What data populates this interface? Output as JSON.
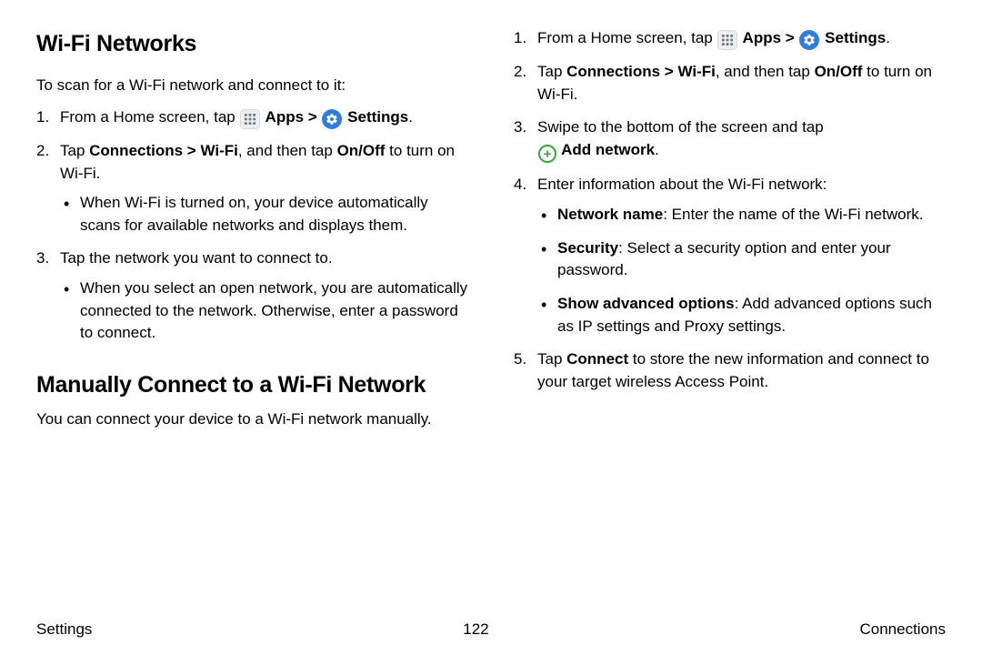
{
  "left": {
    "h1": "Wi-Fi Networks",
    "intro": "To scan for a Wi-Fi network and connect to it:",
    "step1_a": "From a Home screen, tap ",
    "step1_apps": " Apps",
    "step1_sep": " > ",
    "step1_settings": " Settings",
    "step1_end": ".",
    "step2_a": "Tap ",
    "step2_b": "Connections > Wi-Fi",
    "step2_c": ", and then tap ",
    "step2_d": "On/Off",
    "step2_e": " to turn on Wi-Fi.",
    "step2_bullet": "When Wi-Fi is turned on, your device automatically scans for available networks and displays them.",
    "step3": "Tap the network you want to connect to.",
    "step3_bullet": "When you select an open network, you are automatically connected to the network. Otherwise, enter a password to connect.",
    "h2": "Manually Connect to a Wi-Fi Network",
    "manual_intro": "You can connect your device to a Wi-Fi network manually."
  },
  "right": {
    "step1_a": "From a Home screen, tap ",
    "step1_apps": " Apps",
    "step1_sep": " > ",
    "step1_settings": " Settings",
    "step1_end": ".",
    "step2_a": "Tap ",
    "step2_b": "Connections > Wi-Fi",
    "step2_c": ", and then tap ",
    "step2_d": "On/Off",
    "step2_e": " to turn on Wi-Fi.",
    "step3_a": "Swipe to the bottom of the screen and tap ",
    "step3_b": " Add network",
    "step3_c": ".",
    "step4": "Enter information about the Wi-Fi network:",
    "b1_a": "Network name",
    "b1_b": ": Enter the name of the Wi-Fi network.",
    "b2_a": "Security",
    "b2_b": ": Select a security option and enter your password.",
    "b3_a": "Show advanced options",
    "b3_b": ": Add advanced options such as IP settings and Proxy settings.",
    "step5_a": "Tap ",
    "step5_b": "Connect",
    "step5_c": " to store the new information and connect to your target wireless Access Point."
  },
  "footer": {
    "left": "Settings",
    "center": "122",
    "right": "Connections"
  }
}
